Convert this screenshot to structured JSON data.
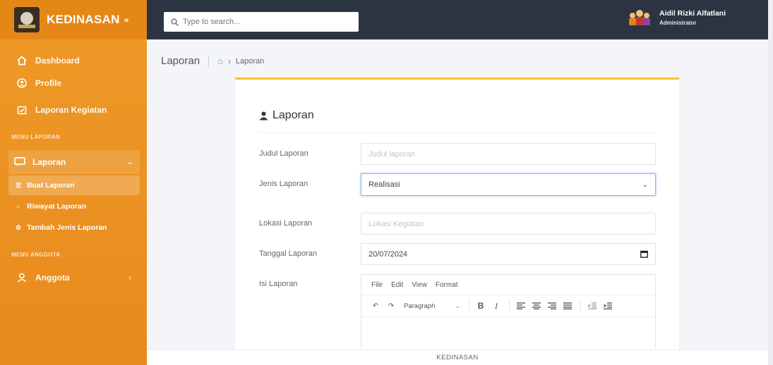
{
  "brand": {
    "name": "KEDINASAN",
    "toggle": "»"
  },
  "sidebar": {
    "items": [
      {
        "label": "Dashboard",
        "icon": "home-icon"
      },
      {
        "label": "Profile",
        "icon": "profile-icon"
      },
      {
        "label": "Laporan Kegiatan",
        "icon": "calendar-icon"
      }
    ],
    "section_laporan": "MENU LAPORAN",
    "group_laporan": {
      "label": "Laporan",
      "icon": "chat-icon"
    },
    "sub_items": [
      {
        "label": "Buat Laporan",
        "icon": "list-icon",
        "active": true
      },
      {
        "label": "Riwayat Laporan",
        "icon": "circle-icon",
        "active": false
      },
      {
        "label": "Tambah Jenis Laporan",
        "icon": "gear-icon",
        "active": false
      }
    ],
    "section_anggota": "MENU ANGGOTA",
    "group_anggota": {
      "label": "Anggota",
      "icon": "user-icon"
    }
  },
  "topbar": {
    "search_placeholder": "Type to search...",
    "user_name": "Aidil Rizki Alfatlani",
    "user_role": "Administrator"
  },
  "breadcrumb": {
    "title": "Laporan",
    "current": "Laporan"
  },
  "form": {
    "title": "Laporan",
    "judul": {
      "label": "Judul Laporan",
      "placeholder": "Judul laporan",
      "value": ""
    },
    "jenis": {
      "label": "Jenis Laporan",
      "value": "Realisasi"
    },
    "lokasi": {
      "label": "Lokasi Laporan",
      "placeholder": "Lokasi Kegiatan",
      "value": ""
    },
    "tanggal": {
      "label": "Tanggal Laporan",
      "value": "20/07/2024"
    },
    "isi": {
      "label": "Isi Laporan",
      "menu": [
        "File",
        "Edit",
        "View",
        "Format"
      ],
      "block_format": "Paragraph",
      "bold": "B",
      "italic": "I"
    }
  },
  "footer": {
    "text": "KEDINASAN"
  },
  "colors": {
    "sidebar": "#ec921f",
    "topbar": "#2b3440",
    "card_accent": "#f4c430",
    "focus": "#8ab4e8"
  }
}
